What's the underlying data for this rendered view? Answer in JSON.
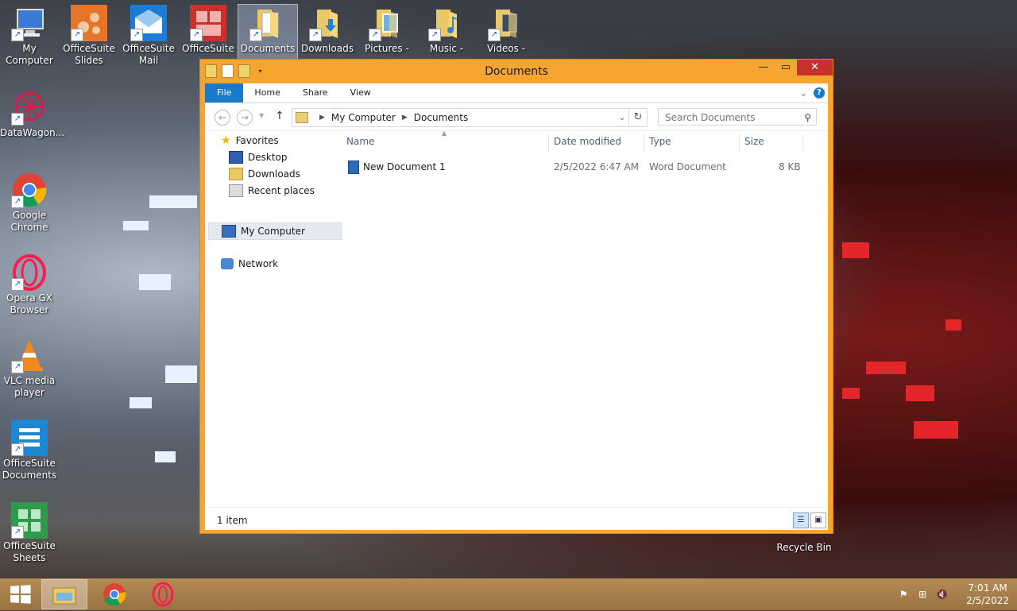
{
  "desktop": {
    "icons_left": [
      {
        "label": "My Computer",
        "icon": "computer-icon"
      },
      {
        "label": "DataWagon...",
        "icon": "datawagon-icon"
      },
      {
        "label": "Google Chrome",
        "icon": "chrome-icon"
      },
      {
        "label": "Opera GX Browser",
        "icon": "opera-icon"
      },
      {
        "label": "VLC media player",
        "icon": "vlc-icon"
      },
      {
        "label": "OfficeSuite Documents",
        "icon": "officesuite-documents-icon"
      },
      {
        "label": "OfficeSuite Sheets",
        "icon": "officesuite-sheets-icon"
      }
    ],
    "icons_top": [
      {
        "label": "OfficeSuite Slides",
        "icon": "officesuite-slides-icon"
      },
      {
        "label": "OfficeSuite Mail",
        "icon": "officesuite-mail-icon"
      },
      {
        "label": "OfficeSuite",
        "icon": "officesuite-icon"
      },
      {
        "label": "Documents -",
        "icon": "documents-folder-icon"
      },
      {
        "label": "Downloads -",
        "icon": "downloads-folder-icon"
      },
      {
        "label": "Pictures -",
        "icon": "pictures-folder-icon"
      },
      {
        "label": "Music -",
        "icon": "music-folder-icon"
      },
      {
        "label": "Videos -",
        "icon": "videos-folder-icon"
      }
    ],
    "recycle_bin": "Recycle Bin"
  },
  "window": {
    "title": "Documents",
    "accent": "#f6a531",
    "ribbon_tabs": {
      "file": "File",
      "home": "Home",
      "share": "Share",
      "view": "View"
    },
    "address": {
      "root": "My Computer",
      "current": "Documents"
    },
    "search_placeholder": "Search Documents",
    "nav": {
      "favorites": "Favorites",
      "desktop": "Desktop",
      "downloads": "Downloads",
      "recent": "Recent places",
      "my_computer": "My Computer",
      "network": "Network"
    },
    "columns": {
      "name": "Name",
      "date": "Date modified",
      "type": "Type",
      "size": "Size"
    },
    "files": [
      {
        "name": "New Document 1",
        "date": "2/5/2022 6:47 AM",
        "type": "Word Document",
        "size": "8 KB"
      }
    ],
    "status": "1 item"
  },
  "taskbar": {
    "time": "7:01 AM",
    "date": "2/5/2022"
  }
}
